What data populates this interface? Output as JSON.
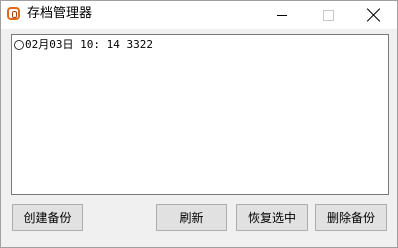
{
  "window": {
    "title": "存档管理器",
    "controls": [
      "minimize-icon",
      "maximize-icon",
      "close-icon"
    ]
  },
  "saves": {
    "items": [
      {
        "label": "02月03日 10: 14 3322",
        "selected": false
      }
    ]
  },
  "buttons": {
    "create_backup": "创建备份",
    "refresh": "刷新",
    "restore_selected": "恢复选中",
    "delete_backup": "删除备份"
  }
}
